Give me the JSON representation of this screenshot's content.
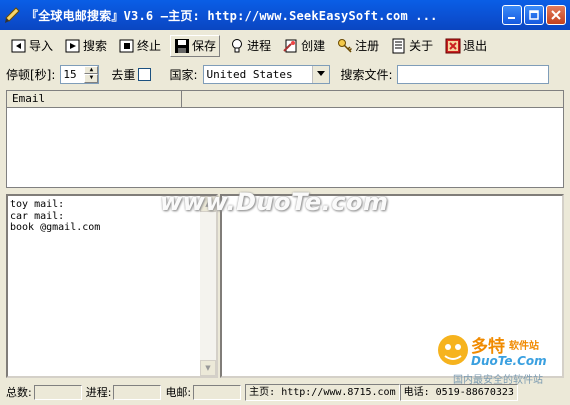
{
  "window": {
    "title": "『全球电邮搜索』V3.6  —主页: http://www.SeekEasySoft.com ..."
  },
  "toolbar": {
    "items": [
      {
        "label": "导入",
        "icon": "import-icon"
      },
      {
        "label": "搜索",
        "icon": "search-play-icon"
      },
      {
        "label": "终止",
        "icon": "stop-icon"
      },
      {
        "label": "保存",
        "icon": "save-icon"
      },
      {
        "label": "进程",
        "icon": "process-bulb-icon"
      },
      {
        "label": "创建",
        "icon": "create-icon"
      },
      {
        "label": "注册",
        "icon": "key-icon"
      },
      {
        "label": "关于",
        "icon": "about-icon"
      },
      {
        "label": "退出",
        "icon": "exit-icon"
      }
    ]
  },
  "options": {
    "pause_label": "停顿[秒]:",
    "pause_value": "15",
    "dedupe_label": "去重",
    "country_label": "国家:",
    "country_value": "United States",
    "search_file_label": "搜索文件:"
  },
  "results_table": {
    "columns": [
      "Email",
      ""
    ]
  },
  "keywords": {
    "lines": [
      "toy mail:",
      "car mail:",
      "book @gmail.com"
    ]
  },
  "statusbar": {
    "total_label": "总数:",
    "progress_label": "进程:",
    "email_label": "电邮:",
    "homepage": "主页: http://www.8715.com",
    "phone": "电话: 0519-88670323"
  },
  "watermark": {
    "text": "www.DuoTe.com",
    "logo_cn": "多特",
    "logo_sub": "软件站",
    "logo_en": "DuoTe.Com",
    "logo_tag": "国内最安全的软件站"
  },
  "colors": {
    "titlebar": "#0b4fd1",
    "window_bg": "#ece9d8"
  }
}
